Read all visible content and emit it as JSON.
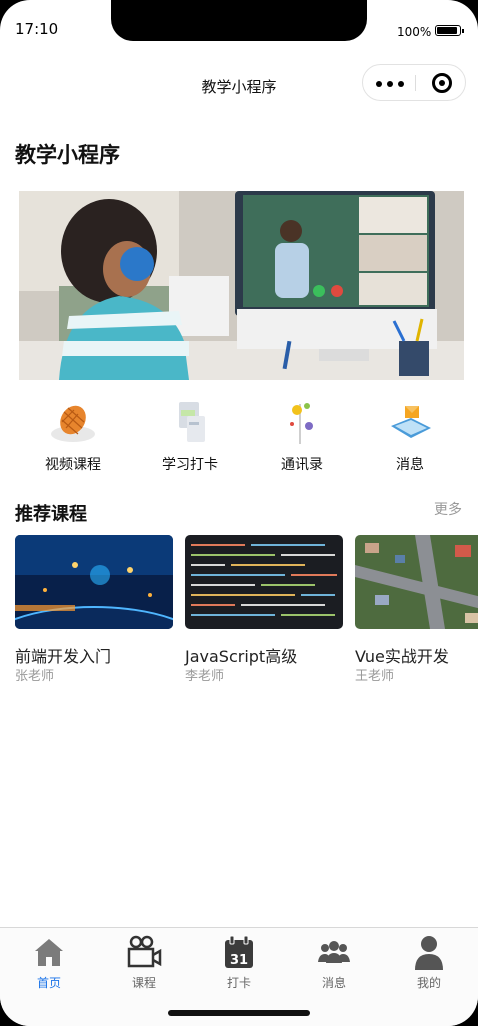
{
  "status_bar": {
    "time": "17:10",
    "battery": "100%"
  },
  "nav": {
    "title": "教学小程序",
    "more_icon": "more-dots-icon",
    "close_icon": "target-circle-icon"
  },
  "page": {
    "heading": "教学小程序"
  },
  "banner": {
    "slide_count": 2,
    "active_index": 1
  },
  "menu": [
    {
      "label": "视频课程",
      "icon": "video-course-icon"
    },
    {
      "label": "学习打卡",
      "icon": "study-checkin-icon"
    },
    {
      "label": "通讯录",
      "icon": "contacts-icon"
    },
    {
      "label": "消息",
      "icon": "message-icon"
    }
  ],
  "recommend": {
    "title": "推荐课程",
    "more": "更多",
    "courses": [
      {
        "title": "前端开发入门",
        "teacher": "张老师"
      },
      {
        "title": "JavaScript高级",
        "teacher": "李老师"
      },
      {
        "title": "Vue实战开发",
        "teacher": "王老师"
      }
    ]
  },
  "tabbar": {
    "active_color": "#1a73e8",
    "inactive_color": "#666666",
    "items": [
      {
        "label": "首页",
        "icon": "home-icon",
        "active": true
      },
      {
        "label": "课程",
        "icon": "video-camera-icon",
        "active": false
      },
      {
        "label": "打卡",
        "icon": "calendar-icon",
        "active": false
      },
      {
        "label": "消息",
        "icon": "users-icon",
        "active": false
      },
      {
        "label": "我的",
        "icon": "user-icon",
        "active": false
      }
    ]
  },
  "calendar_day": "31"
}
